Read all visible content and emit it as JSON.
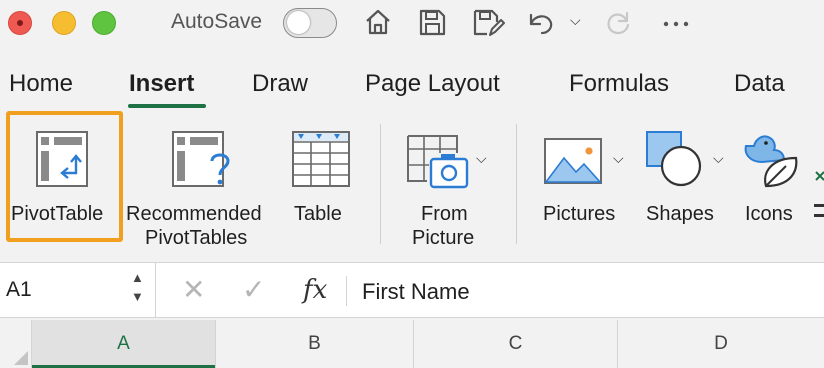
{
  "titlebar": {
    "autosave_label": "AutoSave",
    "autosave_on": false,
    "icons": [
      "home-icon",
      "save-icon",
      "save-as-icon",
      "undo-icon",
      "redo-icon",
      "more-icon"
    ]
  },
  "tabs": [
    {
      "label": "Home",
      "active": false
    },
    {
      "label": "Insert",
      "active": true
    },
    {
      "label": "Draw",
      "active": false
    },
    {
      "label": "Page Layout",
      "active": false
    },
    {
      "label": "Formulas",
      "active": false
    },
    {
      "label": "Data",
      "active": false
    }
  ],
  "ribbon": {
    "pivottable": "PivotTable",
    "recommended_line1": "Recommended",
    "recommended_line2": "PivotTables",
    "table": "Table",
    "from_picture_line1": "From",
    "from_picture_line2": "Picture",
    "pictures": "Pictures",
    "shapes": "Shapes",
    "icons": "Icons"
  },
  "formula_bar": {
    "cell_ref": "A1",
    "fx": "fx",
    "value": "First Name"
  },
  "columns": [
    {
      "label": "A",
      "selected": true
    },
    {
      "label": "B",
      "selected": false
    },
    {
      "label": "C",
      "selected": false
    },
    {
      "label": "D",
      "selected": false
    }
  ],
  "colors": {
    "accent": "#1e7145",
    "highlight": "#f0a01e",
    "icon_blue": "#2b7cd3"
  }
}
